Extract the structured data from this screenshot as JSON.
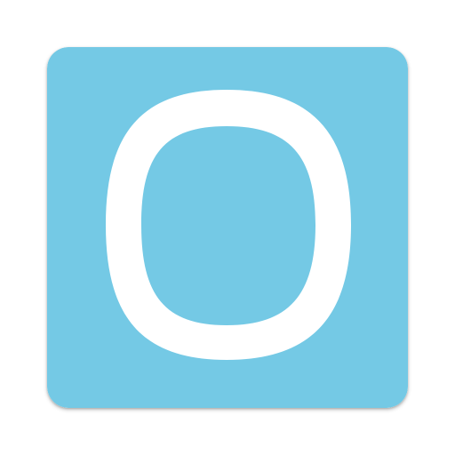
{
  "app_icon": {
    "name": "app-icon",
    "background_color": "#74C9E5",
    "glyph_color": "#FFFFFF",
    "glyph_shape": "rounded-square-ring"
  }
}
